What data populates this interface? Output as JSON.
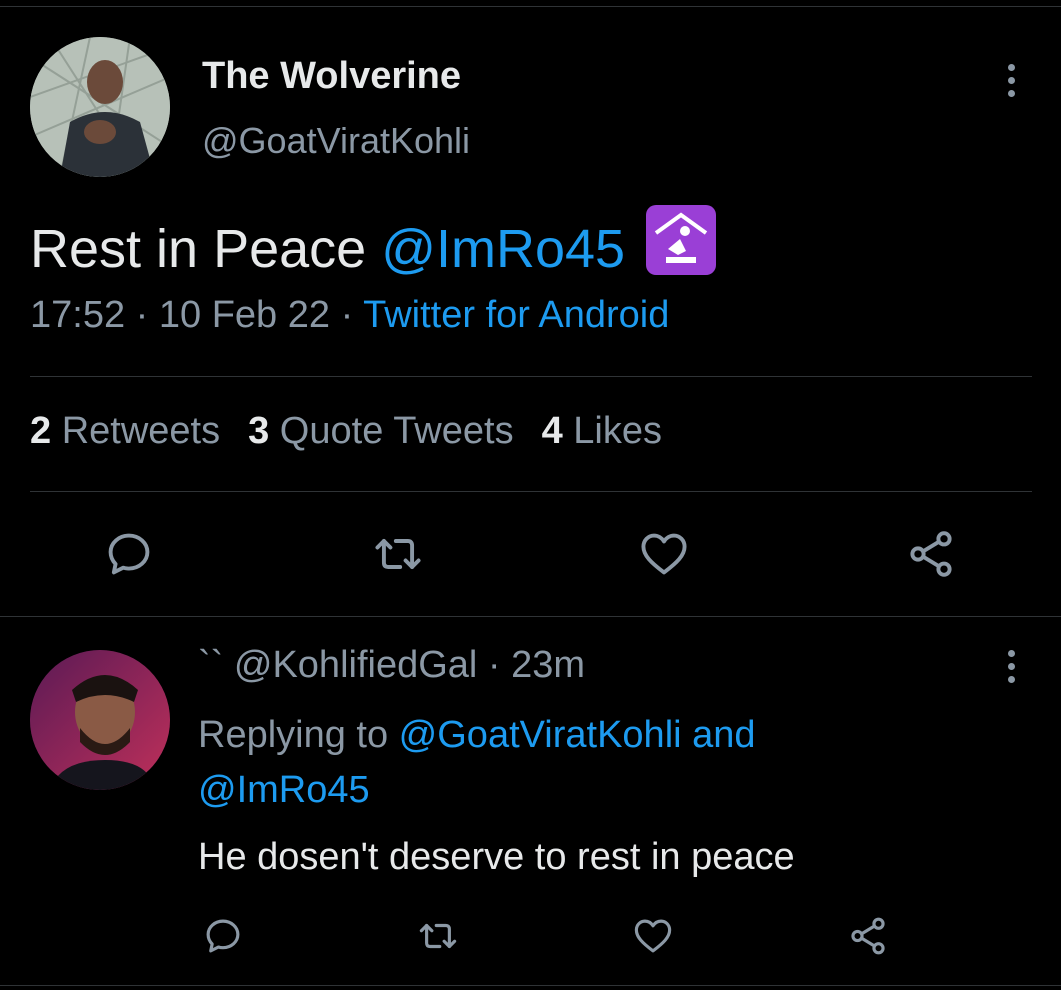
{
  "tweet": {
    "display_name": "The Wolverine",
    "handle": "@GoatViratKohli",
    "text_prefix": "Rest in Peace ",
    "mention": "@ImRo45",
    "emoji_name": "place-of-worship-emoji",
    "time": "17:52",
    "sep1": " · ",
    "date": "10 Feb 22",
    "sep2": " · ",
    "source": "Twitter for Android",
    "retweets_count": "2",
    "retweets_label": " Retweets",
    "quotes_count": "3",
    "quotes_label": " Quote Tweets",
    "likes_count": "4",
    "likes_label": " Likes"
  },
  "reply": {
    "name": "``",
    "handle": "@KohlifiedGal",
    "sep": " · ",
    "age": "23m",
    "replying_prefix": "Replying to ",
    "replying_user1": "@GoatViratKohli",
    "replying_and": " and",
    "replying_user2": "@ImRo45",
    "text": "He dosen't deserve to rest in peace"
  },
  "icons": {
    "more": "more-vertical-icon",
    "reply": "reply-icon",
    "retweet": "retweet-icon",
    "like": "heart-icon",
    "share": "share-icon"
  },
  "colors": {
    "background": "#000000",
    "text": "#e7e9ea",
    "muted": "#8b98a5",
    "link": "#1d9bf0",
    "divider": "#2f3336",
    "emoji_bg": "#9a3fd6"
  }
}
